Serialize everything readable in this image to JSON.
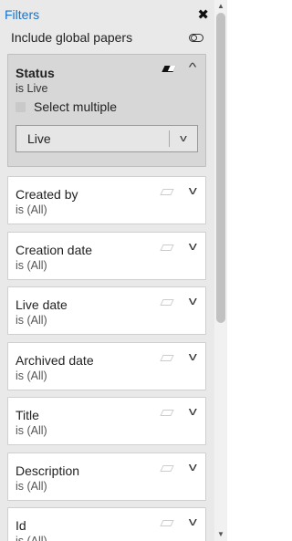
{
  "header": {
    "title": "Filters",
    "close_icon": "close-icon"
  },
  "global": {
    "label": "Include global papers",
    "toggle_icon": "toggle-icon"
  },
  "status": {
    "name": "Status",
    "value": "is Live",
    "multi_label": "Select multiple",
    "selected": "Live"
  },
  "filters": [
    {
      "name": "Created by",
      "value": "is (All)"
    },
    {
      "name": "Creation date",
      "value": "is (All)"
    },
    {
      "name": "Live date",
      "value": "is (All)"
    },
    {
      "name": "Archived date",
      "value": "is (All)"
    },
    {
      "name": "Title",
      "value": "is (All)"
    },
    {
      "name": "Description",
      "value": "is (All)"
    },
    {
      "name": "Id",
      "value": "is (All)"
    }
  ],
  "colors": {
    "accent": "#1a73c8",
    "panel_bg": "#e9e9e9",
    "active_card_bg": "#d7d7d7"
  }
}
